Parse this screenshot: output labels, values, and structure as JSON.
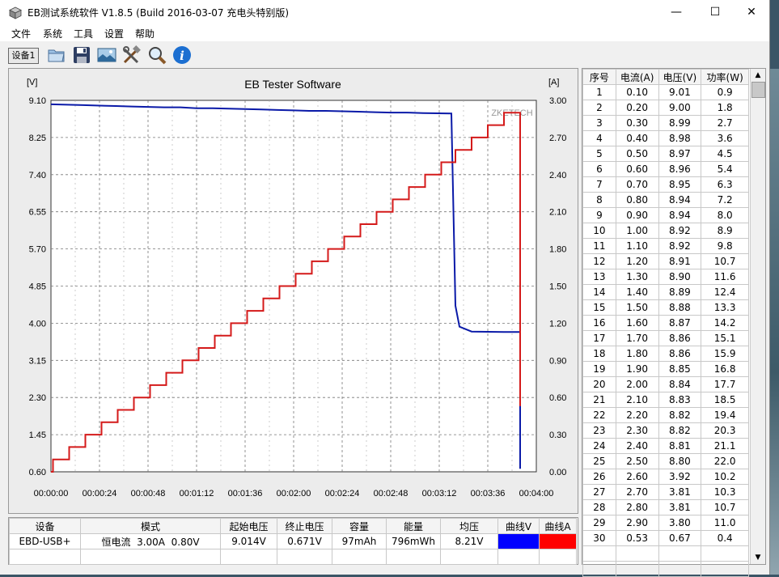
{
  "window": {
    "title": "EB测试系统软件 V1.8.5 (Build 2016-03-07 充电头特别版)",
    "minimize": "—",
    "maximize": "☐",
    "close": "✕"
  },
  "menu": [
    "文件",
    "系统",
    "工具",
    "设置",
    "帮助"
  ],
  "toolbar": {
    "device_button": "设备1",
    "icons": [
      "open-folder-icon",
      "save-icon",
      "image-icon",
      "tools-icon",
      "search-icon",
      "info-icon"
    ]
  },
  "chart_data": {
    "type": "line",
    "title": "EB Tester Software",
    "left_unit": "[V]",
    "right_unit": "[A]",
    "watermark": "ZKETECH",
    "y_left_ticks": [
      "9.10",
      "8.25",
      "7.40",
      "6.55",
      "5.70",
      "4.85",
      "4.00",
      "3.15",
      "2.30",
      "1.45",
      "0.60"
    ],
    "y_right_ticks": [
      "3.00",
      "2.70",
      "2.40",
      "2.10",
      "1.80",
      "1.50",
      "1.20",
      "0.90",
      "0.60",
      "0.30",
      "0.00"
    ],
    "x_ticks": [
      "00:00:00",
      "00:00:24",
      "00:00:48",
      "00:01:12",
      "00:01:36",
      "00:02:00",
      "00:02:24",
      "00:02:48",
      "00:03:12",
      "00:03:36",
      "00:04:00"
    ],
    "ylim_left": [
      0.6,
      9.1
    ],
    "ylim_right": [
      0.0,
      3.0
    ],
    "xlim_seconds": [
      0,
      240
    ],
    "grid": true,
    "series": [
      {
        "axis": "left",
        "color": "#0a1aa8",
        "points": [
          [
            0,
            9.01
          ],
          [
            8,
            9.0
          ],
          [
            16,
            8.99
          ],
          [
            24,
            8.98
          ],
          [
            32,
            8.97
          ],
          [
            40,
            8.96
          ],
          [
            48,
            8.95
          ],
          [
            56,
            8.94
          ],
          [
            64,
            8.94
          ],
          [
            72,
            8.92
          ],
          [
            80,
            8.92
          ],
          [
            88,
            8.91
          ],
          [
            96,
            8.9
          ],
          [
            104,
            8.89
          ],
          [
            112,
            8.88
          ],
          [
            120,
            8.87
          ],
          [
            128,
            8.86
          ],
          [
            136,
            8.86
          ],
          [
            144,
            8.85
          ],
          [
            152,
            8.84
          ],
          [
            160,
            8.83
          ],
          [
            168,
            8.82
          ],
          [
            176,
            8.82
          ],
          [
            184,
            8.81
          ],
          [
            198,
            8.8
          ],
          [
            200,
            4.4
          ],
          [
            202,
            3.92
          ],
          [
            208,
            3.81
          ],
          [
            224,
            3.8
          ],
          [
            231,
            3.8
          ],
          [
            232,
            3.8
          ],
          [
            232,
            0.67
          ]
        ]
      },
      {
        "axis": "right",
        "color": "#d41a1a",
        "points": [
          [
            0,
            0.0
          ],
          [
            1,
            0.0
          ],
          [
            1,
            0.1
          ],
          [
            9,
            0.1
          ],
          [
            9,
            0.2
          ],
          [
            17,
            0.2
          ],
          [
            17,
            0.3
          ],
          [
            25,
            0.3
          ],
          [
            25,
            0.4
          ],
          [
            33,
            0.4
          ],
          [
            33,
            0.5
          ],
          [
            41,
            0.5
          ],
          [
            41,
            0.6
          ],
          [
            49,
            0.6
          ],
          [
            49,
            0.7
          ],
          [
            57,
            0.7
          ],
          [
            57,
            0.8
          ],
          [
            65,
            0.8
          ],
          [
            65,
            0.9
          ],
          [
            73,
            0.9
          ],
          [
            73,
            1.0
          ],
          [
            81,
            1.0
          ],
          [
            81,
            1.1
          ],
          [
            89,
            1.1
          ],
          [
            89,
            1.2
          ],
          [
            97,
            1.2
          ],
          [
            97,
            1.3
          ],
          [
            105,
            1.3
          ],
          [
            105,
            1.4
          ],
          [
            113,
            1.4
          ],
          [
            113,
            1.5
          ],
          [
            121,
            1.5
          ],
          [
            121,
            1.6
          ],
          [
            129,
            1.6
          ],
          [
            129,
            1.7
          ],
          [
            137,
            1.7
          ],
          [
            137,
            1.8
          ],
          [
            145,
            1.8
          ],
          [
            145,
            1.9
          ],
          [
            153,
            1.9
          ],
          [
            153,
            2.0
          ],
          [
            161,
            2.0
          ],
          [
            161,
            2.1
          ],
          [
            169,
            2.1
          ],
          [
            169,
            2.2
          ],
          [
            177,
            2.2
          ],
          [
            177,
            2.3
          ],
          [
            185,
            2.3
          ],
          [
            185,
            2.4
          ],
          [
            193,
            2.4
          ],
          [
            193,
            2.5
          ],
          [
            200,
            2.5
          ],
          [
            200,
            2.6
          ],
          [
            208,
            2.6
          ],
          [
            208,
            2.7
          ],
          [
            216,
            2.7
          ],
          [
            216,
            2.8
          ],
          [
            224,
            2.8
          ],
          [
            224,
            2.9
          ],
          [
            232,
            2.9
          ],
          [
            232,
            0.53
          ]
        ]
      }
    ]
  },
  "table": {
    "headers": [
      "序号",
      "电流(A)",
      "电压(V)",
      "功率(W)"
    ],
    "rows": [
      [
        "1",
        "0.10",
        "9.01",
        "0.9"
      ],
      [
        "2",
        "0.20",
        "9.00",
        "1.8"
      ],
      [
        "3",
        "0.30",
        "8.99",
        "2.7"
      ],
      [
        "4",
        "0.40",
        "8.98",
        "3.6"
      ],
      [
        "5",
        "0.50",
        "8.97",
        "4.5"
      ],
      [
        "6",
        "0.60",
        "8.96",
        "5.4"
      ],
      [
        "7",
        "0.70",
        "8.95",
        "6.3"
      ],
      [
        "8",
        "0.80",
        "8.94",
        "7.2"
      ],
      [
        "9",
        "0.90",
        "8.94",
        "8.0"
      ],
      [
        "10",
        "1.00",
        "8.92",
        "8.9"
      ],
      [
        "11",
        "1.10",
        "8.92",
        "9.8"
      ],
      [
        "12",
        "1.20",
        "8.91",
        "10.7"
      ],
      [
        "13",
        "1.30",
        "8.90",
        "11.6"
      ],
      [
        "14",
        "1.40",
        "8.89",
        "12.4"
      ],
      [
        "15",
        "1.50",
        "8.88",
        "13.3"
      ],
      [
        "16",
        "1.60",
        "8.87",
        "14.2"
      ],
      [
        "17",
        "1.70",
        "8.86",
        "15.1"
      ],
      [
        "18",
        "1.80",
        "8.86",
        "15.9"
      ],
      [
        "19",
        "1.90",
        "8.85",
        "16.8"
      ],
      [
        "20",
        "2.00",
        "8.84",
        "17.7"
      ],
      [
        "21",
        "2.10",
        "8.83",
        "18.5"
      ],
      [
        "22",
        "2.20",
        "8.82",
        "19.4"
      ],
      [
        "23",
        "2.30",
        "8.82",
        "20.3"
      ],
      [
        "24",
        "2.40",
        "8.81",
        "21.1"
      ],
      [
        "25",
        "2.50",
        "8.80",
        "22.0"
      ],
      [
        "26",
        "2.60",
        "3.92",
        "10.2"
      ],
      [
        "27",
        "2.70",
        "3.81",
        "10.3"
      ],
      [
        "28",
        "2.80",
        "3.81",
        "10.7"
      ],
      [
        "29",
        "2.90",
        "3.80",
        "11.0"
      ],
      [
        "30",
        "0.53",
        "0.67",
        "0.4"
      ]
    ]
  },
  "summary": {
    "headers": [
      "设备",
      "模式",
      "起始电压",
      "终止电压",
      "容量",
      "能量",
      "均压",
      "曲线V",
      "曲线A"
    ],
    "row": [
      "EBD-USB+",
      "恒电流  3.00A  0.80V",
      "9.014V",
      "0.671V",
      "97mAh",
      "796mWh",
      "8.21V",
      "",
      ""
    ],
    "curve_v_color": "#0000ff",
    "curve_a_color": "#ff0000"
  }
}
